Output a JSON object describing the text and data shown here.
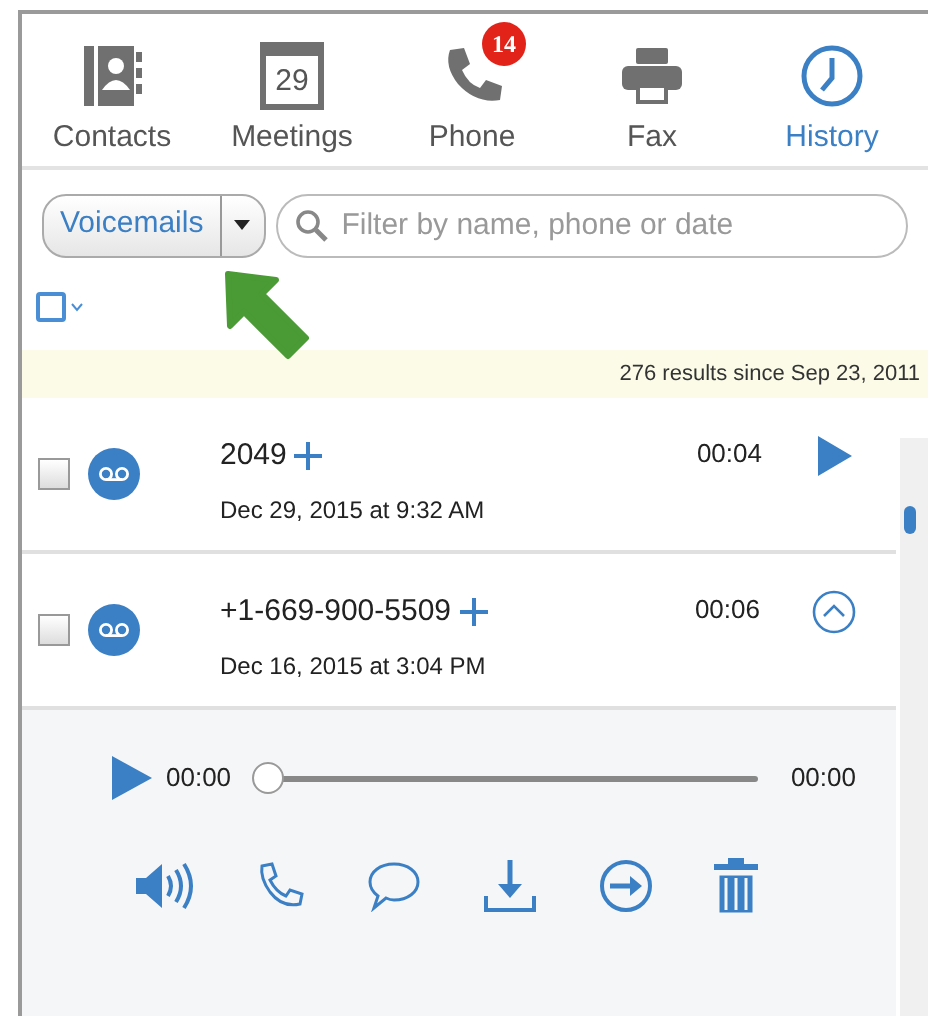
{
  "tabs": [
    {
      "label": "Contacts",
      "selected": false
    },
    {
      "label": "Meetings",
      "day": "29",
      "selected": false
    },
    {
      "label": "Phone",
      "badge": "14",
      "selected": false
    },
    {
      "label": "Fax",
      "selected": false
    },
    {
      "label": "History",
      "selected": true
    }
  ],
  "filter": {
    "type": "Voicemails",
    "placeholder": "Filter by name, phone or date"
  },
  "select_all": {
    "checked": false
  },
  "results_summary": "276 results since Sep 23, 2011",
  "voicemails": [
    {
      "caller": "2049",
      "date": "Dec 29, 2015 at 9:32 AM",
      "duration": "00:04",
      "checked": false,
      "expanded": false
    },
    {
      "caller": "+1-669-900-5509",
      "date": "Dec 16, 2015 at 3:04 PM",
      "duration": "00:06",
      "checked": false,
      "expanded": true
    }
  ],
  "player": {
    "elapsed": "00:00",
    "total": "00:00",
    "level": 0
  }
}
